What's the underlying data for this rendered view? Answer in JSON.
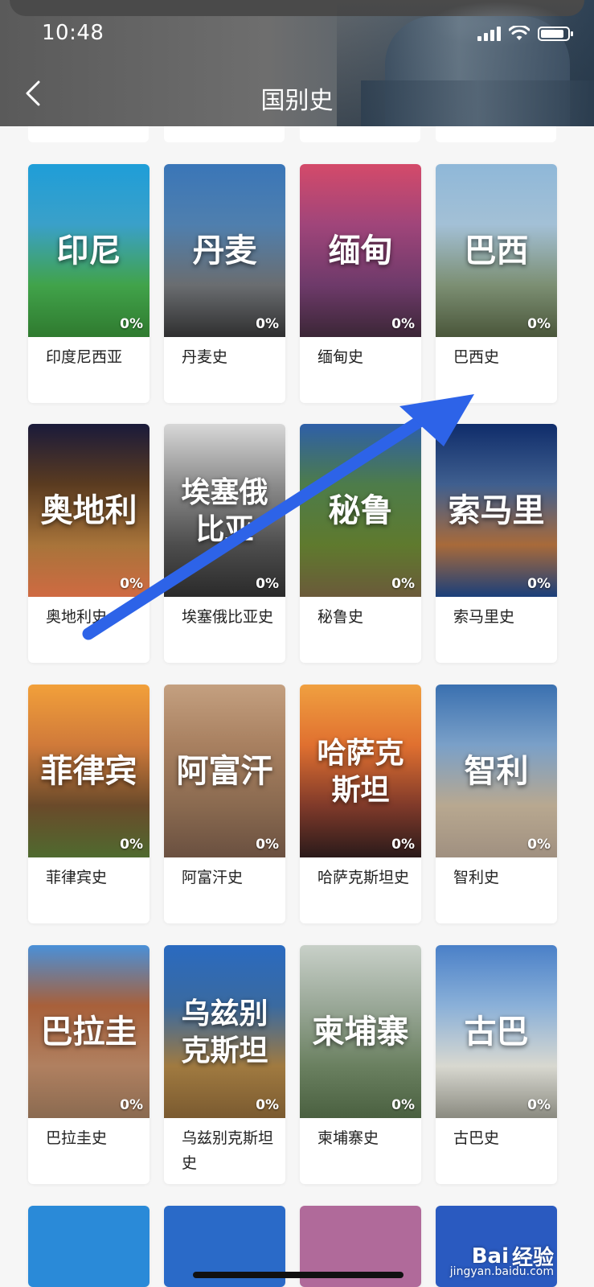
{
  "status_bar": {
    "time": "10:48"
  },
  "header": {
    "title": "国别史",
    "back_icon": "chevron-left-icon"
  },
  "cards": [
    {
      "thumb_label": "印尼",
      "title": "印度尼西亚",
      "progress": "0%",
      "colors": [
        "#1f9ed8",
        "#3aa0c9",
        "#41a34a",
        "#2f7a2f"
      ]
    },
    {
      "thumb_label": "丹麦",
      "title": "丹麦史",
      "progress": "0%",
      "colors": [
        "#3a76b8",
        "#4f7fae",
        "#6a6d70",
        "#2f2f30"
      ]
    },
    {
      "thumb_label": "缅甸",
      "title": "缅甸史",
      "progress": "0%",
      "colors": [
        "#d44a6a",
        "#a0457a",
        "#6e3a6a",
        "#3b2636"
      ]
    },
    {
      "thumb_label": "巴西",
      "title": "巴西史",
      "progress": "0%",
      "colors": [
        "#8fb8d8",
        "#a3c0d6",
        "#7c8f73",
        "#4a563a"
      ]
    },
    {
      "thumb_label": "奥地利",
      "title": "奥地利史",
      "progress": "0%",
      "colors": [
        "#1a1a3a",
        "#5a3b20",
        "#a8743a",
        "#cf6a42"
      ]
    },
    {
      "thumb_label": "埃塞俄比亚",
      "title": "埃塞俄比亚史",
      "progress": "0%",
      "colors": [
        "#d8d8d8",
        "#8c8c8c",
        "#4d4d4d",
        "#2a2a2a"
      ]
    },
    {
      "thumb_label": "秘鲁",
      "title": "秘鲁史",
      "progress": "0%",
      "colors": [
        "#2e5fa8",
        "#4d7c4a",
        "#5f7a2e",
        "#6b5a3a"
      ]
    },
    {
      "thumb_label": "索马里",
      "title": "索马里史",
      "progress": "0%",
      "colors": [
        "#0f2c6a",
        "#3f5f8f",
        "#a86a3a",
        "#1a3f7a"
      ]
    },
    {
      "thumb_label": "菲律宾",
      "title": "菲律宾史",
      "progress": "0%",
      "colors": [
        "#f2a03a",
        "#d07a3a",
        "#6a4a2a",
        "#4f6a2f"
      ]
    },
    {
      "thumb_label": "阿富汗",
      "title": "阿富汗史",
      "progress": "0%",
      "colors": [
        "#c4a080",
        "#a88060",
        "#8a6a50",
        "#6a5040"
      ]
    },
    {
      "thumb_label": "哈萨克斯坦",
      "title": "哈萨克斯坦史",
      "progress": "0%",
      "colors": [
        "#f0a040",
        "#e07030",
        "#803a2a",
        "#2a1a1a"
      ]
    },
    {
      "thumb_label": "智利",
      "title": "智利史",
      "progress": "0%",
      "colors": [
        "#3a70b0",
        "#7aa0c8",
        "#b8a890",
        "#a09080"
      ]
    },
    {
      "thumb_label": "巴拉圭",
      "title": "巴拉圭史",
      "progress": "0%",
      "colors": [
        "#4a90d8",
        "#a8603a",
        "#b08060",
        "#8a6a50"
      ]
    },
    {
      "thumb_label": "乌兹别克斯坦",
      "title": "乌兹别克斯坦史",
      "progress": "0%",
      "colors": [
        "#2a6ac0",
        "#3a6aa0",
        "#a07a40",
        "#7a5a30"
      ]
    },
    {
      "thumb_label": "柬埔寨",
      "title": "柬埔寨史",
      "progress": "0%",
      "colors": [
        "#c8d0c8",
        "#9aa898",
        "#6a8060",
        "#4a6040"
      ]
    },
    {
      "thumb_label": "古巴",
      "title": "古巴史",
      "progress": "0%",
      "colors": [
        "#4a80c8",
        "#8ab0d8",
        "#d8d8d0",
        "#8a8a80"
      ]
    }
  ],
  "next_row_colors": [
    "#2a8ad8",
    "#2a6ac8",
    "#b06a9a",
    "#2a5ac0"
  ],
  "watermark": {
    "brand": "Bai",
    "brand2": "经验",
    "sub": "jingyan.baidu.com"
  }
}
